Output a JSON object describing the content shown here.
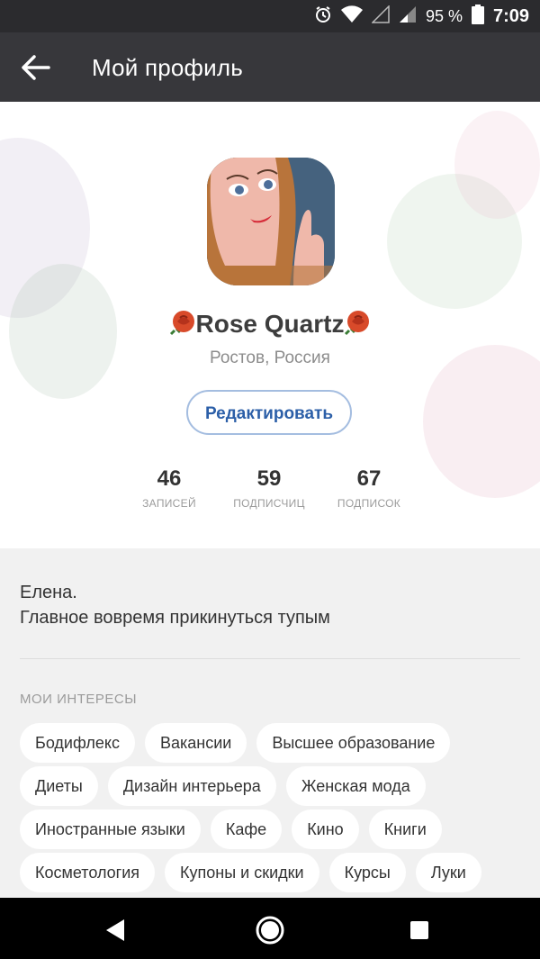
{
  "status_bar": {
    "battery": "95 %",
    "time": "7:09"
  },
  "app_bar": {
    "title": "Мой профиль"
  },
  "profile": {
    "name": "Rose Quartz",
    "location": "Ростов, Россия",
    "edit_label": "Редактировать",
    "stats": [
      {
        "value": "46",
        "label": "ЗАПИСЕЙ"
      },
      {
        "value": "59",
        "label": "ПОДПИСЧИЦ"
      },
      {
        "value": "67",
        "label": "ПОДПИСОК"
      }
    ]
  },
  "about": {
    "line1": "Елена.",
    "line2": "Главное вовремя прикинуться тупым"
  },
  "interests": {
    "heading": "МОИ ИНТЕРЕСЫ",
    "items": [
      "Бодифлекс",
      "Вакансии",
      "Высшее образование",
      "Диеты",
      "Дизайн интерьера",
      "Женская мода",
      "Иностранные языки",
      "Кафе",
      "Кино",
      "Книги",
      "Косметология",
      "Купоны и скидки",
      "Курсы",
      "Луки"
    ]
  },
  "icons": [
    "alarm-icon",
    "wifi-icon",
    "signal-icon",
    "battery-icon",
    "back-arrow-icon",
    "rose-icon",
    "nav-back-icon",
    "nav-home-icon",
    "nav-recents-icon"
  ]
}
